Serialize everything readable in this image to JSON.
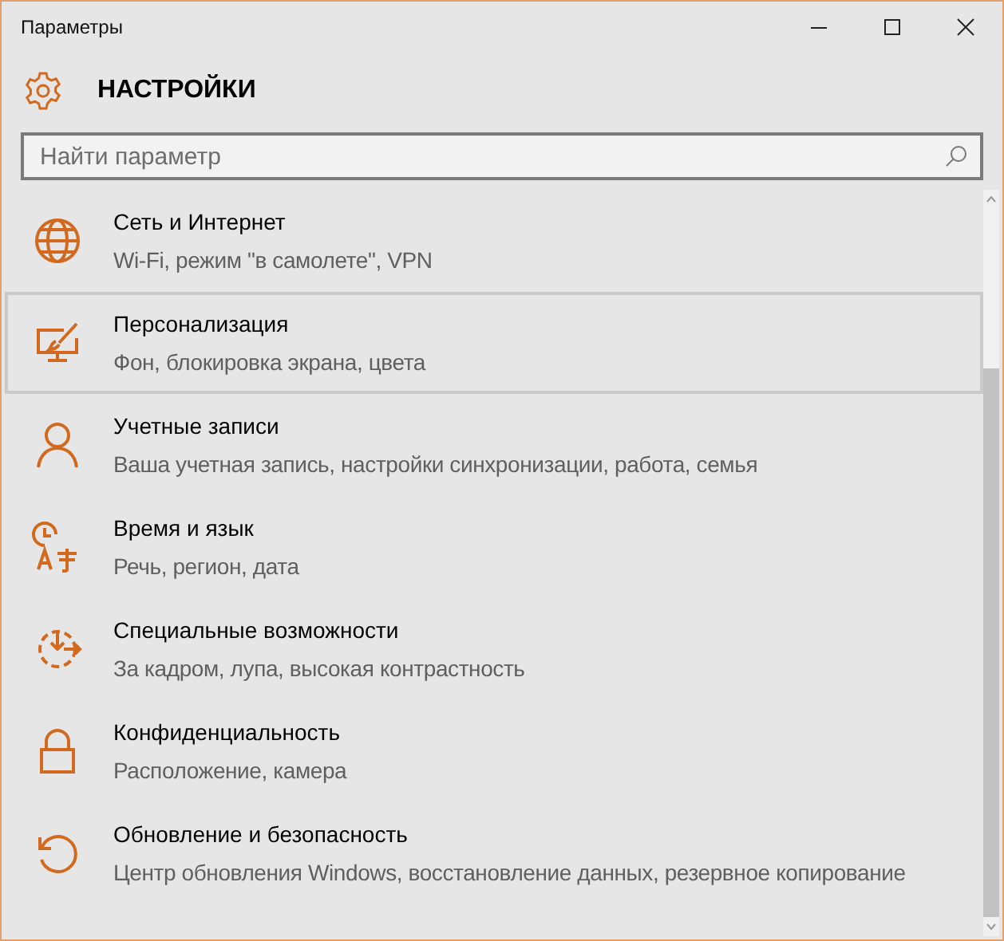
{
  "window": {
    "title": "Параметры"
  },
  "header": {
    "title": "НАСТРОЙКИ"
  },
  "search": {
    "placeholder": "Найти параметр"
  },
  "categories": [
    {
      "title": "Сеть и Интернет",
      "subtitle": "Wi-Fi, режим \"в самолете\", VPN",
      "selected": false
    },
    {
      "title": "Персонализация",
      "subtitle": "Фон, блокировка экрана, цвета",
      "selected": true
    },
    {
      "title": "Учетные записи",
      "subtitle": "Ваша учетная запись, настройки синхронизации, работа, семья",
      "selected": false
    },
    {
      "title": "Время и язык",
      "subtitle": "Речь, регион, дата",
      "selected": false
    },
    {
      "title": "Специальные возможности",
      "subtitle": "За кадром, лупа, высокая контрастность",
      "selected": false
    },
    {
      "title": "Конфиденциальность",
      "subtitle": "Расположение, камера",
      "selected": false
    },
    {
      "title": "Обновление и безопасность",
      "subtitle": "Центр обновления Windows, восстановление данных, резервное копирование",
      "selected": false
    }
  ]
}
